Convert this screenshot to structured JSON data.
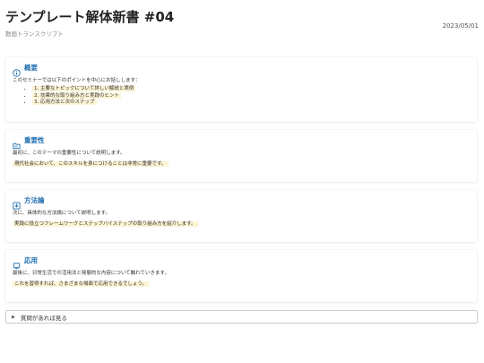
{
  "header": {
    "title": "テンプレート解体新書 #04",
    "subtitle": "動画トランスクリプト",
    "date": "2023/05/01"
  },
  "overview": {
    "title": "概要",
    "icon": "info-icon",
    "intro": "このセミナーでは以下のポイントを中心にお話しします：",
    "points": [
      "1. 主要なトピックについて詳しい解説と実例",
      "2. 効果的な取り組み方と実践のヒント",
      "3. 応用方法と次のステップ"
    ]
  },
  "importance": {
    "title": "重要性",
    "icon": "folder-icon",
    "text": "最初に、このテーマの重要性について説明します。",
    "highlight": "現代社会において、このスキルを身につけることは非常に重要です。"
  },
  "methodology": {
    "title": "方法論",
    "icon": "download-box-icon",
    "text": "次に、具体的な方法論について説明します。",
    "highlight": "実践に役立つフレームワークとステップバイステップの取り組み方を紹介します。"
  },
  "application": {
    "title": "応用",
    "icon": "monitor-icon",
    "text": "最後に、日常生活での活用法と発展的な内容について触れていきます。",
    "highlight": "これを習得すれば、さまざまな場面で応用できるでしょう。"
  },
  "details": {
    "label": "質問があれば見る",
    "arrow": "▶"
  },
  "colors": {
    "accent": "#1f6fb2",
    "highlight": "#fdf4d3"
  }
}
